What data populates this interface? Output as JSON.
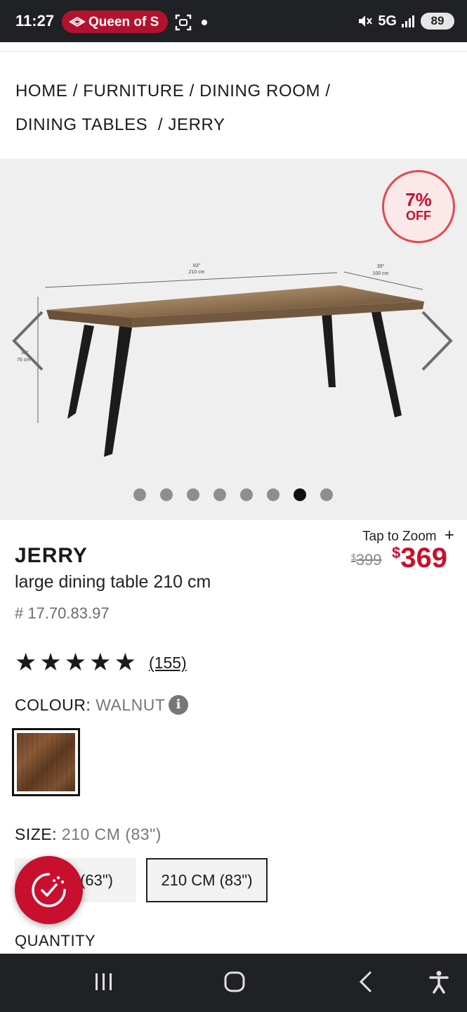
{
  "status_bar": {
    "time": "11:27",
    "app_pill_text": "Queen of S",
    "network": "5G",
    "battery": "89"
  },
  "breadcrumb": {
    "items": [
      "HOME",
      "FURNITURE",
      "DINING ROOM",
      "DINING TABLES",
      "JERRY"
    ],
    "separator": "/"
  },
  "gallery": {
    "discount_percent": "7%",
    "discount_label": "OFF",
    "dimension_labels": {
      "width_in": "83\"",
      "width_cm": "210 cm",
      "depth_in": "39\"",
      "depth_cm": "100 cm",
      "height_in": "30\"",
      "height_cm": "76 cm"
    },
    "image_count": 8,
    "active_index": 6
  },
  "product": {
    "zoom_text": "Tap to Zoom",
    "zoom_icon": "plus-icon",
    "old_price_symbol": "$",
    "old_price": "399",
    "new_price_symbol": "$",
    "new_price": "369",
    "name": "JERRY",
    "description": "large dining table 210 cm",
    "sku": "# 17.70.83.97",
    "rating": 5,
    "review_count": "(155)"
  },
  "colour": {
    "label": "COLOUR:",
    "value": "WALNUT",
    "info_icon": "i"
  },
  "size": {
    "label": "SIZE:",
    "value": "210 CM (83\")",
    "options": [
      "160 CM (63\")",
      "210 CM (83\")"
    ],
    "option1_visible": "(63\")",
    "selected_index": 1
  },
  "quantity": {
    "label": "QUANTITY"
  },
  "colors": {
    "brand_red": "#c8102e",
    "status_bar_bg": "#202124"
  }
}
